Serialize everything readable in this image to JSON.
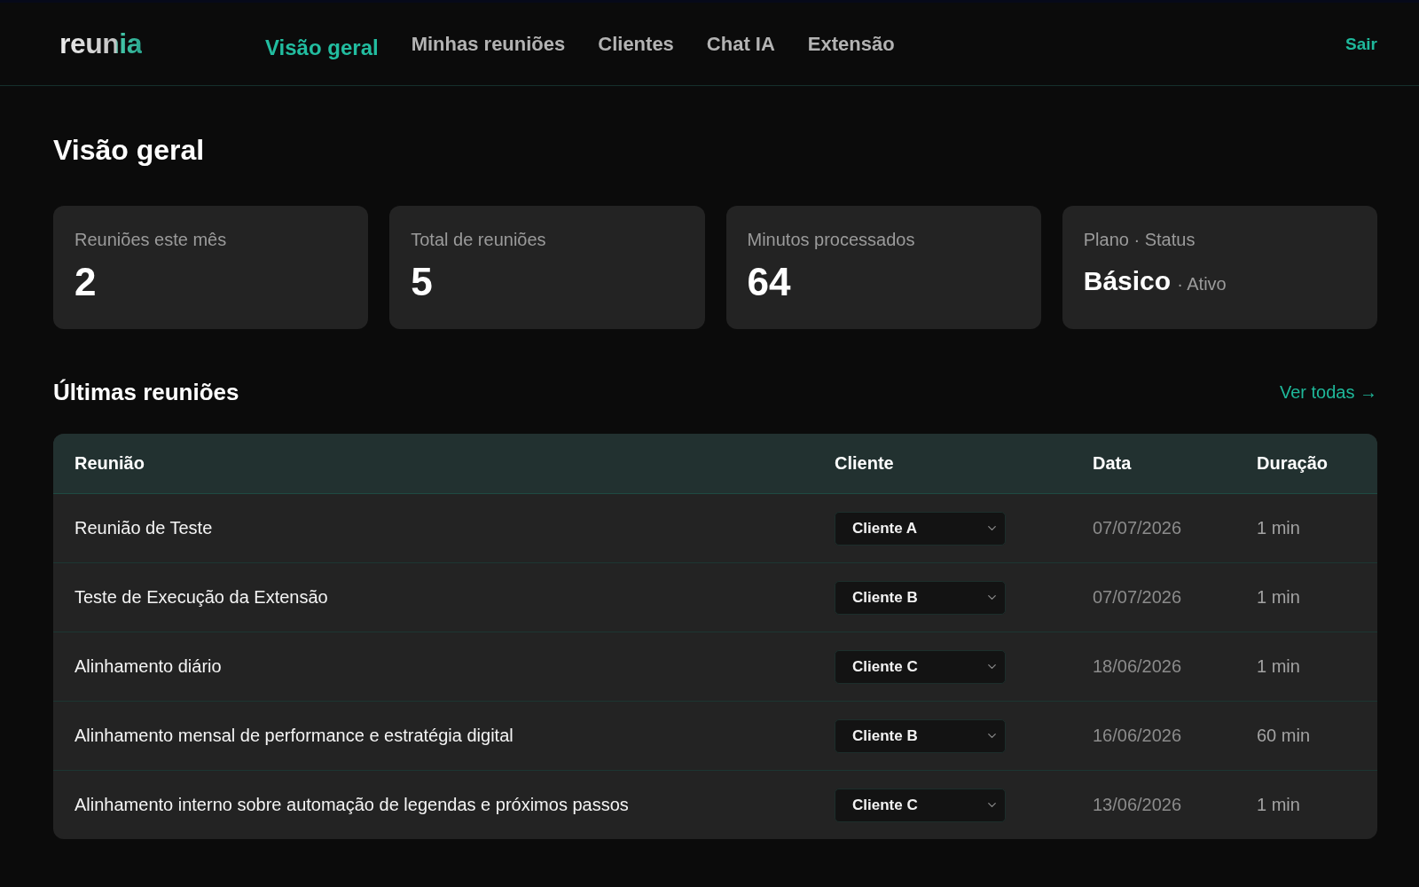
{
  "header": {
    "logo": "reunia",
    "nav": [
      {
        "label": "Visão geral",
        "selected": true
      },
      {
        "label": "Minhas reuniões",
        "selected": false
      },
      {
        "label": "Clientes",
        "selected": false
      },
      {
        "label": "Chat IA",
        "selected": false
      },
      {
        "label": "Extensão",
        "selected": false
      }
    ],
    "logout": "Sair"
  },
  "page_title": "Visão geral",
  "stats": [
    {
      "kind": "count",
      "label": "Reuniões este mês",
      "value": "2"
    },
    {
      "kind": "count",
      "label": "Total de reuniões",
      "value": "5"
    },
    {
      "kind": "count",
      "label": "Minutos processados",
      "value": "64"
    },
    {
      "kind": "plan",
      "label": "Plano · Status",
      "value": "Básico",
      "status": "· Ativo"
    }
  ],
  "recent": {
    "title": "Últimas reuniões",
    "link": "Ver todas →",
    "table": {
      "columns": [
        "Reunião",
        "Cliente",
        "Data",
        "Duração"
      ],
      "rows": [
        {
          "title": "Reunião de Teste",
          "client": "Cliente A",
          "date": "07/07/2026",
          "duration": "1 min"
        },
        {
          "title": "Teste de Execução da Extensão",
          "client": "Cliente B",
          "date": "07/07/2026",
          "duration": "1 min"
        },
        {
          "title": "Alinhamento diário",
          "client": "Cliente C",
          "date": "18/06/2026",
          "duration": "1 min"
        },
        {
          "title": "Alinhamento mensal de performance e estratégia digital",
          "client": "Cliente B",
          "date": "16/06/2026",
          "duration": "60 min"
        },
        {
          "title": "Alinhamento interno sobre automação de legendas e próximos passos",
          "client": "Cliente C",
          "date": "13/06/2026",
          "duration": "1 min"
        }
      ]
    }
  }
}
